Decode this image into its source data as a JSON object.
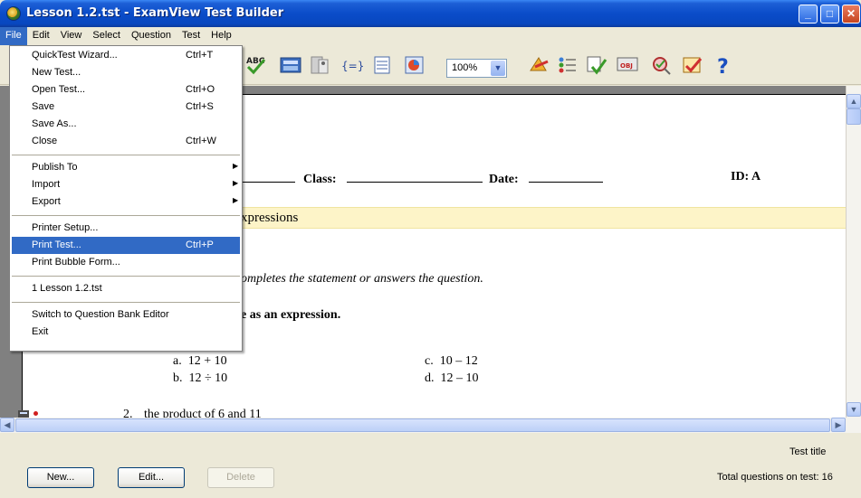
{
  "window": {
    "title": "Lesson 1.2.tst - ExamView Test Builder"
  },
  "menubar": [
    "File",
    "Edit",
    "View",
    "Select",
    "Question",
    "Test",
    "Help"
  ],
  "toolbar": {
    "zoom": "100%"
  },
  "file_menu": {
    "items": [
      {
        "label": "QuickTest Wizard...",
        "shortcut": "Ctrl+T"
      },
      {
        "label": "New Test...",
        "shortcut": ""
      },
      {
        "label": "Open Test...",
        "shortcut": "Ctrl+O"
      },
      {
        "label": "Save",
        "shortcut": "Ctrl+S"
      },
      {
        "label": "Save As...",
        "shortcut": ""
      },
      {
        "label": "Close",
        "shortcut": "Ctrl+W"
      },
      {
        "label": "Publish To",
        "shortcut": ""
      },
      {
        "label": "Import",
        "shortcut": ""
      },
      {
        "label": "Export",
        "shortcut": ""
      },
      {
        "label": "Printer Setup...",
        "shortcut": ""
      },
      {
        "label": "Print Test...",
        "shortcut": "Ctrl+P"
      },
      {
        "label": "Print Bubble Form...",
        "shortcut": ""
      },
      {
        "label": "1 Lesson 1.2.tst",
        "shortcut": ""
      },
      {
        "label": "Switch to Question Bank Editor",
        "shortcut": ""
      },
      {
        "label": "Exit",
        "shortcut": ""
      }
    ]
  },
  "document": {
    "header": {
      "class_label": "Class:",
      "date_label": "Date:",
      "id_label": "ID: A"
    },
    "section_title": "xpressions",
    "instruction": "ompletes the statement or answers the question.",
    "question_prompt": "e as an expression.",
    "choices": {
      "a_letter": "a.",
      "a_text": "12 + 10",
      "b_letter": "b.",
      "b_text": "12 ÷ 10",
      "c_letter": "c.",
      "c_text": "10 – 12",
      "d_letter": "d.",
      "d_text": "12 – 10"
    },
    "question2": {
      "number": "2.",
      "text": "the product of 6 and 11"
    }
  },
  "bottom": {
    "new_label": "New...",
    "edit_label": "Edit...",
    "delete_label": "Delete",
    "test_title_label": "Test title",
    "total_questions": "Total questions on test: 16"
  }
}
